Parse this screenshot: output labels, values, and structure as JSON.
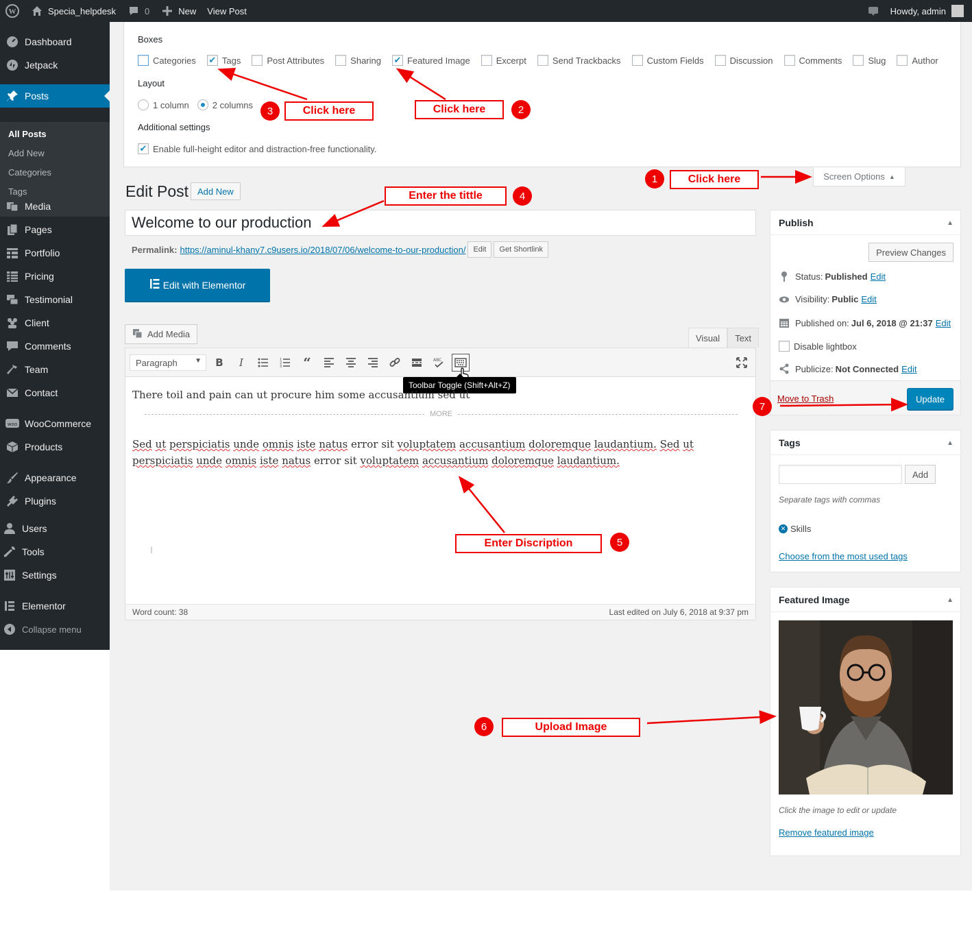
{
  "adminbar": {
    "site_name": "Specia_helpdesk",
    "comments_count": "0",
    "new_label": "New",
    "view_post_label": "View Post",
    "howdy": "Howdy, admin"
  },
  "sidebar": {
    "items": [
      {
        "label": "Dashboard",
        "icon": "dashboard-icon"
      },
      {
        "label": "Jetpack",
        "icon": "jetpack-icon"
      },
      {
        "label": "Posts",
        "icon": "pushpin-icon"
      },
      {
        "label": "Media",
        "icon": "media-icon"
      },
      {
        "label": "Pages",
        "icon": "pages-icon"
      },
      {
        "label": "Portfolio",
        "icon": "grid-icon"
      },
      {
        "label": "Pricing",
        "icon": "table-icon"
      },
      {
        "label": "Testimonial",
        "icon": "testimonial-icon"
      },
      {
        "label": "Client",
        "icon": "client-icon"
      },
      {
        "label": "Comments",
        "icon": "comment-icon"
      },
      {
        "label": "Team",
        "icon": "hammer-icon"
      },
      {
        "label": "Contact",
        "icon": "mail-icon"
      },
      {
        "label": "WooCommerce",
        "icon": "woo-icon"
      },
      {
        "label": "Products",
        "icon": "archive-icon"
      },
      {
        "label": "Appearance",
        "icon": "brush-icon"
      },
      {
        "label": "Plugins",
        "icon": "plugin-icon"
      },
      {
        "label": "Users",
        "icon": "user-icon"
      },
      {
        "label": "Tools",
        "icon": "wrench-icon"
      },
      {
        "label": "Settings",
        "icon": "settings-icon"
      },
      {
        "label": "Elementor",
        "icon": "elementor-icon"
      },
      {
        "label": "Collapse menu",
        "icon": "collapse-icon"
      }
    ],
    "posts_submenu": [
      "All Posts",
      "Add New",
      "Categories",
      "Tags"
    ]
  },
  "screen_options": {
    "boxes_heading": "Boxes",
    "boxes": [
      {
        "label": "Categories",
        "checked": false
      },
      {
        "label": "Tags",
        "checked": true
      },
      {
        "label": "Post Attributes",
        "checked": false
      },
      {
        "label": "Sharing",
        "checked": false
      },
      {
        "label": "Featured Image",
        "checked": true
      },
      {
        "label": "Excerpt",
        "checked": false
      },
      {
        "label": "Send Trackbacks",
        "checked": false
      },
      {
        "label": "Custom Fields",
        "checked": false
      },
      {
        "label": "Discussion",
        "checked": false
      },
      {
        "label": "Comments",
        "checked": false
      },
      {
        "label": "Slug",
        "checked": false
      },
      {
        "label": "Author",
        "checked": false
      }
    ],
    "layout_heading": "Layout",
    "layout_options": [
      "1 column",
      "2 columns"
    ],
    "layout_selected": "2 columns",
    "additional_heading": "Additional settings",
    "additional_option": "Enable full-height editor and distraction-free functionality.",
    "tab_label": "Screen Options"
  },
  "edit": {
    "page_title": "Edit Post",
    "add_new": "Add New",
    "post_title": "Welcome to our production",
    "permalink_label": "Permalink:",
    "permalink_url": "https://aminul-khany7.c9users.io/2018/07/06/welcome-to-our-production/",
    "edit_btn": "Edit",
    "shortlink_btn": "Get Shortlink",
    "elementor_btn": "Edit with Elementor",
    "add_media": "Add Media",
    "tab_visual": "Visual",
    "tab_text": "Text",
    "format_select": "Paragraph",
    "tooltip": "Toolbar Toggle (Shift+Alt+Z)",
    "para1": "There toil and pain can ut procure him some accusantium sed ut",
    "more_label": "MORE",
    "para2": "Sed ut perspiciatis unde omnis iste natus error sit voluptatem accusantium doloremque laudantium. Sed ut perspiciatis unde omnis iste natus error sit voluptatem accusantium doloremque laudantium.",
    "word_count": "Word count: 38",
    "last_edited": "Last edited on July 6, 2018 at 9:37 pm"
  },
  "publish": {
    "title": "Publish",
    "preview": "Preview Changes",
    "status_label": "Status:",
    "status_value": "Published",
    "visibility_label": "Visibility:",
    "visibility_value": "Public",
    "published_label": "Published on:",
    "published_value": "Jul 6, 2018 @ 21:37",
    "lightbox_label": "Disable lightbox",
    "publicize_label": "Publicize:",
    "publicize_value": "Not Connected",
    "edit_link": "Edit",
    "trash": "Move to Trash",
    "update": "Update"
  },
  "tags_box": {
    "title": "Tags",
    "add": "Add",
    "hint": "Separate tags with commas",
    "tag": "Skills",
    "choose": "Choose from the most used tags"
  },
  "featured_box": {
    "title": "Featured Image",
    "hint": "Click the image to edit or update",
    "remove": "Remove featured image"
  },
  "annotations": [
    {
      "num": "1",
      "label": "Click here"
    },
    {
      "num": "2",
      "label": "Click here"
    },
    {
      "num": "3",
      "label": "Click here"
    },
    {
      "num": "4",
      "label": "Enter the tittle"
    },
    {
      "num": "5",
      "label": "Enter  Discription"
    },
    {
      "num": "6",
      "label": "Upload Image"
    },
    {
      "num": "7",
      "label": ""
    }
  ],
  "colors": {
    "admin_dark": "#23282d",
    "wp_blue": "#0073aa",
    "annotation_red": "#e00000"
  }
}
